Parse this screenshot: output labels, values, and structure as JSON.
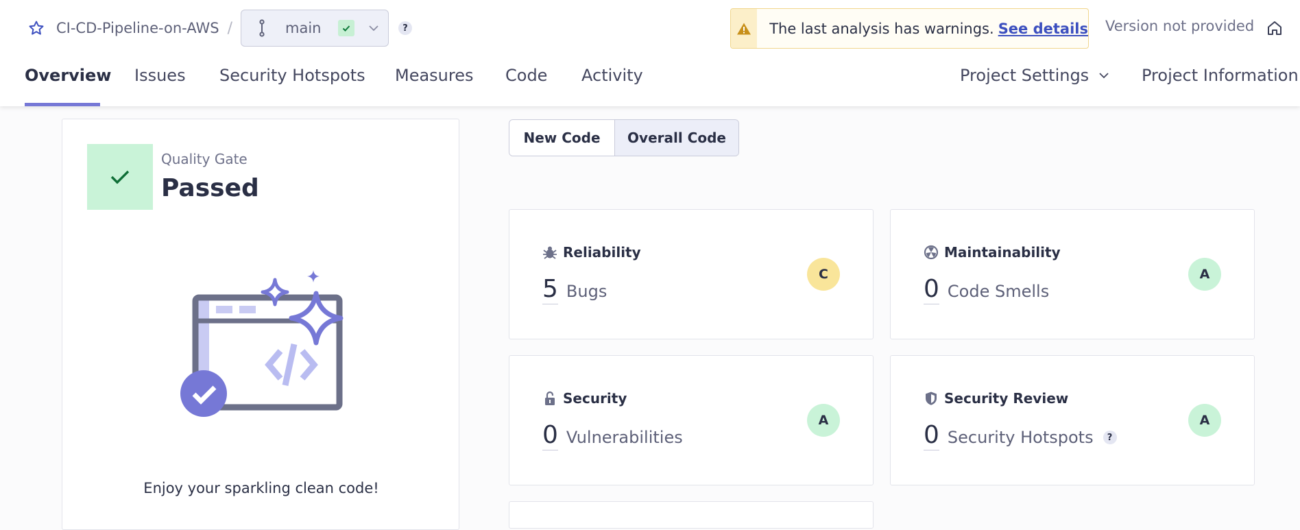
{
  "header": {
    "project_name": "CI-CD-Pipeline-on-AWS",
    "separator": "/",
    "branch": "main",
    "help": "?",
    "warning_text": "The last analysis has warnings.",
    "warning_link": "See details",
    "version": "Version not provided"
  },
  "tabs": [
    {
      "label": "Overview",
      "active": true
    },
    {
      "label": "Issues",
      "active": false
    },
    {
      "label": "Security Hotspots",
      "active": false
    },
    {
      "label": "Measures",
      "active": false
    },
    {
      "label": "Code",
      "active": false
    },
    {
      "label": "Activity",
      "active": false
    }
  ],
  "right_nav": {
    "settings": "Project Settings",
    "info": "Project Information"
  },
  "quality_gate": {
    "label": "Quality Gate",
    "status": "Passed",
    "message": "Enjoy your sparkling clean code!"
  },
  "code_toggle": {
    "new_code": "New Code",
    "overall_code": "Overall Code",
    "selected": "Overall Code"
  },
  "metrics": [
    {
      "title": "Reliability",
      "icon": "bug-icon",
      "value": "5",
      "unit": "Bugs",
      "rating": "C"
    },
    {
      "title": "Maintainability",
      "icon": "code-smell-icon",
      "value": "0",
      "unit": "Code Smells",
      "rating": "A"
    },
    {
      "title": "Security",
      "icon": "lock-icon",
      "value": "0",
      "unit": "Vulnerabilities",
      "rating": "A"
    },
    {
      "title": "Security Review",
      "icon": "shield-icon",
      "value": "0",
      "unit": "Security Hotspots",
      "rating": "A"
    }
  ],
  "colors": {
    "accent": "#7678d6",
    "rating_c": "#f9e59a",
    "rating_a": "#c9f3d8",
    "warning_bg": "#fcefc9"
  }
}
